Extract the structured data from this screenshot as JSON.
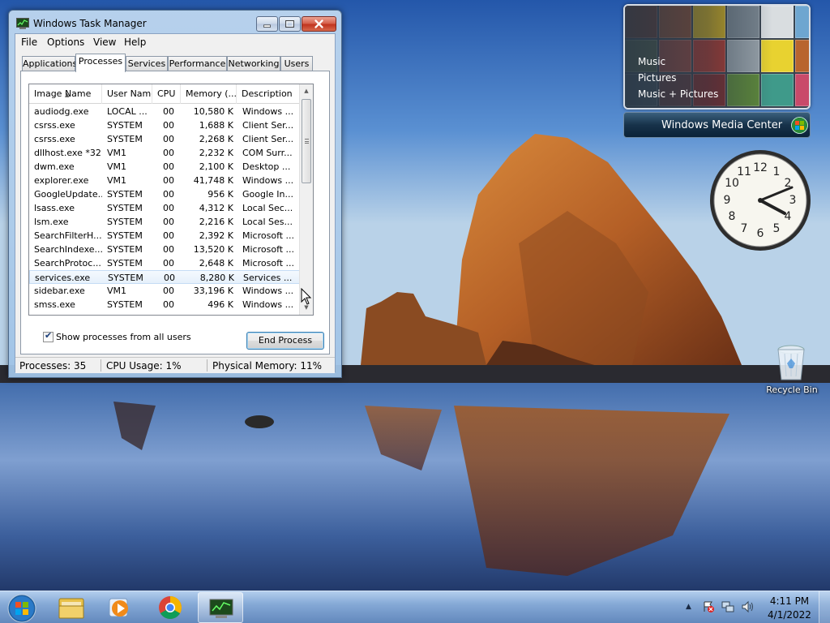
{
  "window": {
    "title": "Windows Task Manager",
    "menu": [
      "File",
      "Options",
      "View",
      "Help"
    ],
    "tabs": [
      "Applications",
      "Processes",
      "Services",
      "Performance",
      "Networking",
      "Users"
    ],
    "active_tab": "Processes"
  },
  "process_table": {
    "columns": [
      "Image Name",
      "User Name",
      "CPU",
      "Memory (...",
      "Description"
    ],
    "sorted_by": "Image Name",
    "rows": [
      {
        "name": "audiodg.exe",
        "user": "LOCAL ...",
        "cpu": "00",
        "memory": "10,580 K",
        "description": "Windows ..."
      },
      {
        "name": "csrss.exe",
        "user": "SYSTEM",
        "cpu": "00",
        "memory": "1,688 K",
        "description": "Client Ser..."
      },
      {
        "name": "csrss.exe",
        "user": "SYSTEM",
        "cpu": "00",
        "memory": "2,268 K",
        "description": "Client Ser..."
      },
      {
        "name": "dllhost.exe *32",
        "user": "VM1",
        "cpu": "00",
        "memory": "2,232 K",
        "description": "COM Surr..."
      },
      {
        "name": "dwm.exe",
        "user": "VM1",
        "cpu": "00",
        "memory": "2,100 K",
        "description": "Desktop ..."
      },
      {
        "name": "explorer.exe",
        "user": "VM1",
        "cpu": "00",
        "memory": "41,748 K",
        "description": "Windows ..."
      },
      {
        "name": "GoogleUpdate...",
        "user": "SYSTEM",
        "cpu": "00",
        "memory": "956 K",
        "description": "Google In..."
      },
      {
        "name": "lsass.exe",
        "user": "SYSTEM",
        "cpu": "00",
        "memory": "4,312 K",
        "description": "Local Sec..."
      },
      {
        "name": "lsm.exe",
        "user": "SYSTEM",
        "cpu": "00",
        "memory": "2,216 K",
        "description": "Local Ses..."
      },
      {
        "name": "SearchFilterH...",
        "user": "SYSTEM",
        "cpu": "00",
        "memory": "2,392 K",
        "description": "Microsoft ..."
      },
      {
        "name": "SearchIndexe...",
        "user": "SYSTEM",
        "cpu": "00",
        "memory": "13,520 K",
        "description": "Microsoft ..."
      },
      {
        "name": "SearchProtoc...",
        "user": "SYSTEM",
        "cpu": "00",
        "memory": "2,648 K",
        "description": "Microsoft ..."
      },
      {
        "name": "services.exe",
        "user": "SYSTEM",
        "cpu": "00",
        "memory": "8,280 K",
        "description": "Services ...",
        "hover": true
      },
      {
        "name": "sidebar.exe",
        "user": "VM1",
        "cpu": "00",
        "memory": "33,196 K",
        "description": "Windows ..."
      },
      {
        "name": "smss.exe",
        "user": "SYSTEM",
        "cpu": "00",
        "memory": "496 K",
        "description": "Windows ..."
      }
    ]
  },
  "show_all": {
    "label": "Show processes from all users",
    "checked": true
  },
  "end_process_label": "End Process",
  "status": {
    "processes": "Processes: 35",
    "cpu": "CPU Usage: 1%",
    "memory": "Physical Memory: 11%"
  },
  "media_center": {
    "links": [
      "Music",
      "Pictures",
      "Music + Pictures"
    ],
    "bar_label": "Windows Media Center"
  },
  "recycle_bin_label": "Recycle Bin",
  "taskbar": {
    "pinned": [
      "file-explorer-icon",
      "media-player-icon",
      "chrome-icon",
      "task-manager-icon"
    ],
    "active": "task-manager-icon",
    "time": "4:11 PM",
    "date": "4/1/2022"
  },
  "colors": {
    "selection": "#3c7fb1",
    "title_close": "#c1341f"
  }
}
